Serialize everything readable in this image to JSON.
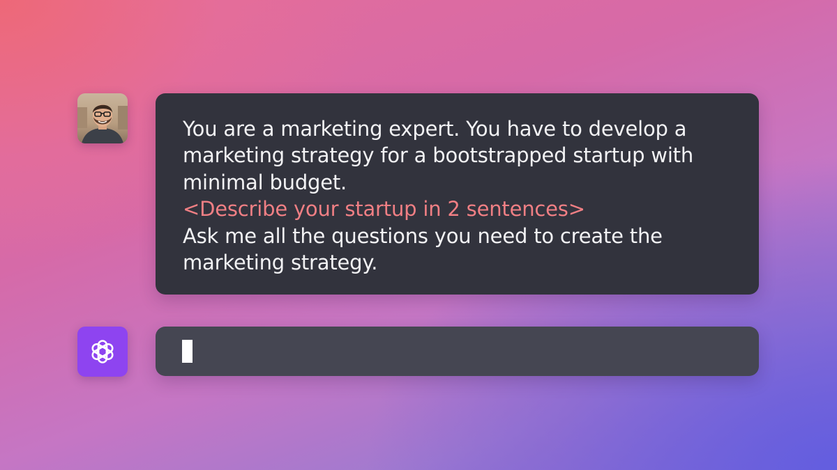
{
  "conversation": {
    "user_message": {
      "avatar_icon": "user-avatar-photo",
      "lines": [
        "You are a marketing expert. You have to develop a",
        "marketing strategy for a bootstrapped startup with",
        "minimal budget.",
        "<Describe your startup in 2 sentences>",
        "Ask me all the questions you need to create the",
        "marketing strategy."
      ],
      "highlighted_line_index": 3,
      "highlight_color": "#f07f84"
    },
    "assistant_message": {
      "avatar_icon": "openai-logo-icon",
      "avatar_color": "#8e44f0",
      "text": ""
    }
  },
  "colors": {
    "prompt_bubble": "#32333d",
    "response_bubble": "#454652",
    "text": "#f2f2f4"
  }
}
